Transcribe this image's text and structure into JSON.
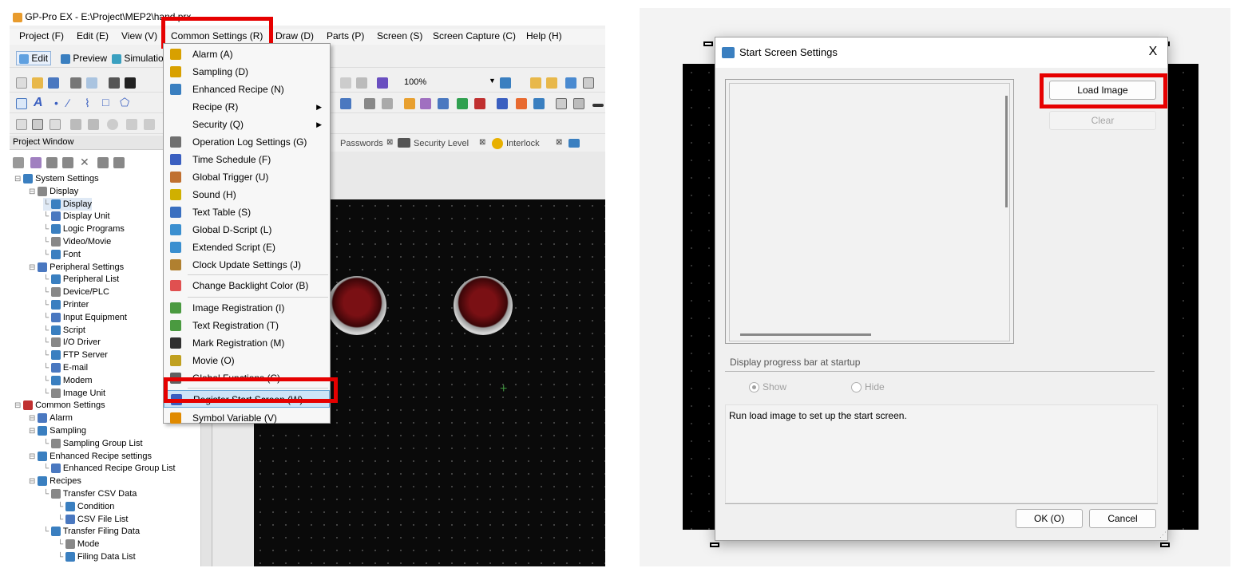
{
  "left": {
    "window_title": "GP-Pro EX - E:\\Project\\MEP2\\hand.prx",
    "menubar": [
      "Project (F)",
      "Edit (E)",
      "View (V)",
      "Common Settings (R)",
      "Draw (D)",
      "Parts (P)",
      "Screen (S)",
      "Screen Capture (C)",
      "Help (H)"
    ],
    "toolbar": {
      "edit": "Edit",
      "preview": "Preview",
      "simulation": "Simulatio",
      "zoom": "100%"
    },
    "tabs": [
      "Passwords",
      "Security Level",
      "Interlock"
    ],
    "project_window": {
      "title": "Project Window",
      "tree": [
        {
          "label": "System Settings",
          "level": 0
        },
        {
          "label": "Display",
          "level": 1
        },
        {
          "label": "Display",
          "level": 2
        },
        {
          "label": "Display Unit",
          "level": 2
        },
        {
          "label": "Logic Programs",
          "level": 2
        },
        {
          "label": "Video/Movie",
          "level": 2
        },
        {
          "label": "Font",
          "level": 2
        },
        {
          "label": "Peripheral Settings",
          "level": 1
        },
        {
          "label": "Peripheral List",
          "level": 2
        },
        {
          "label": "Device/PLC",
          "level": 2
        },
        {
          "label": "Printer",
          "level": 2
        },
        {
          "label": "Input Equipment",
          "level": 2
        },
        {
          "label": "Script",
          "level": 2
        },
        {
          "label": "I/O Driver",
          "level": 2
        },
        {
          "label": "FTP Server",
          "level": 2
        },
        {
          "label": "E-mail",
          "level": 2
        },
        {
          "label": "Modem",
          "level": 2
        },
        {
          "label": "Image Unit",
          "level": 2
        },
        {
          "label": "Common Settings",
          "level": 0
        },
        {
          "label": "Alarm",
          "level": 1
        },
        {
          "label": "Sampling",
          "level": 1
        },
        {
          "label": "Sampling Group List",
          "level": 2
        },
        {
          "label": "Enhanced Recipe settings",
          "level": 1
        },
        {
          "label": "Enhanced Recipe Group List",
          "level": 2
        },
        {
          "label": "Recipes",
          "level": 1
        },
        {
          "label": "Transfer CSV Data",
          "level": 2
        },
        {
          "label": "Condition",
          "level": 3
        },
        {
          "label": "CSV File List",
          "level": 3
        },
        {
          "label": "Transfer Filing Data",
          "level": 2
        },
        {
          "label": "Mode",
          "level": 3
        },
        {
          "label": "Filing Data List",
          "level": 3
        }
      ]
    },
    "dropdown": [
      {
        "label": "Alarm (A)",
        "icon": "alarm-icon",
        "color": "#d8a000"
      },
      {
        "label": "Sampling (D)",
        "icon": "sampling-icon",
        "color": "#d8a000"
      },
      {
        "label": "Enhanced Recipe (N)",
        "icon": "enhanced-recipe-icon",
        "color": "#3a7fc0"
      },
      {
        "label": "Recipe (R)",
        "icon": "",
        "submenu": true
      },
      {
        "label": "Security (Q)",
        "icon": "",
        "submenu": true
      },
      {
        "label": "Operation Log Settings (G)",
        "icon": "operation-log-icon",
        "color": "#707070"
      },
      {
        "label": "Time Schedule (F)",
        "icon": "time-schedule-icon",
        "color": "#3a5fc0"
      },
      {
        "label": "Global Trigger (U)",
        "icon": "global-trigger-icon",
        "color": "#c07030"
      },
      {
        "label": "Sound (H)",
        "icon": "sound-icon",
        "color": "#d0b000"
      },
      {
        "label": "Text Table (S)",
        "icon": "text-table-icon",
        "color": "#3a6fc0"
      },
      {
        "label": "Global D-Script (L)",
        "icon": "global-dscript-icon",
        "color": "#3a8fd0"
      },
      {
        "label": "Extended Script (E)",
        "icon": "extended-script-icon",
        "color": "#3a8fd0"
      },
      {
        "label": "Clock Update Settings (J)",
        "icon": "clock-update-icon",
        "color": "#b08030"
      },
      {
        "label": "Change Backlight Color (B)",
        "icon": "backlight-icon",
        "color": "#e05050"
      },
      {
        "label": "Image Registration (I)",
        "icon": "image-registration-icon",
        "color": "#4a9a40"
      },
      {
        "label": "Text Registration (T)",
        "icon": "text-registration-icon",
        "color": "#4a9a40"
      },
      {
        "label": "Mark Registration (M)",
        "icon": "mark-registration-icon",
        "color": "#303030"
      },
      {
        "label": "Movie (O)",
        "icon": "movie-icon",
        "color": "#c0a020"
      },
      {
        "label": "Global Functions (C)",
        "icon": "global-functions-icon",
        "color": "#606060"
      },
      {
        "label": "Register Start Screen (W)",
        "icon": "register-start-screen-icon",
        "color": "#3a5fc0"
      },
      {
        "label": "Symbol Variable (V)",
        "icon": "symbol-variable-icon",
        "color": "#e08a00"
      }
    ]
  },
  "dialog": {
    "title": "Start Screen Settings",
    "close": "X",
    "load_image": "Load Image",
    "clear": "Clear",
    "group_label": "Display progress bar at startup",
    "radio_show": "Show",
    "radio_hide": "Hide",
    "message": "Run load image to set up the start screen.",
    "ok": "OK (O)",
    "cancel": "Cancel"
  },
  "colors": {
    "highlight": "#e60000",
    "accent": "#0078d7"
  }
}
